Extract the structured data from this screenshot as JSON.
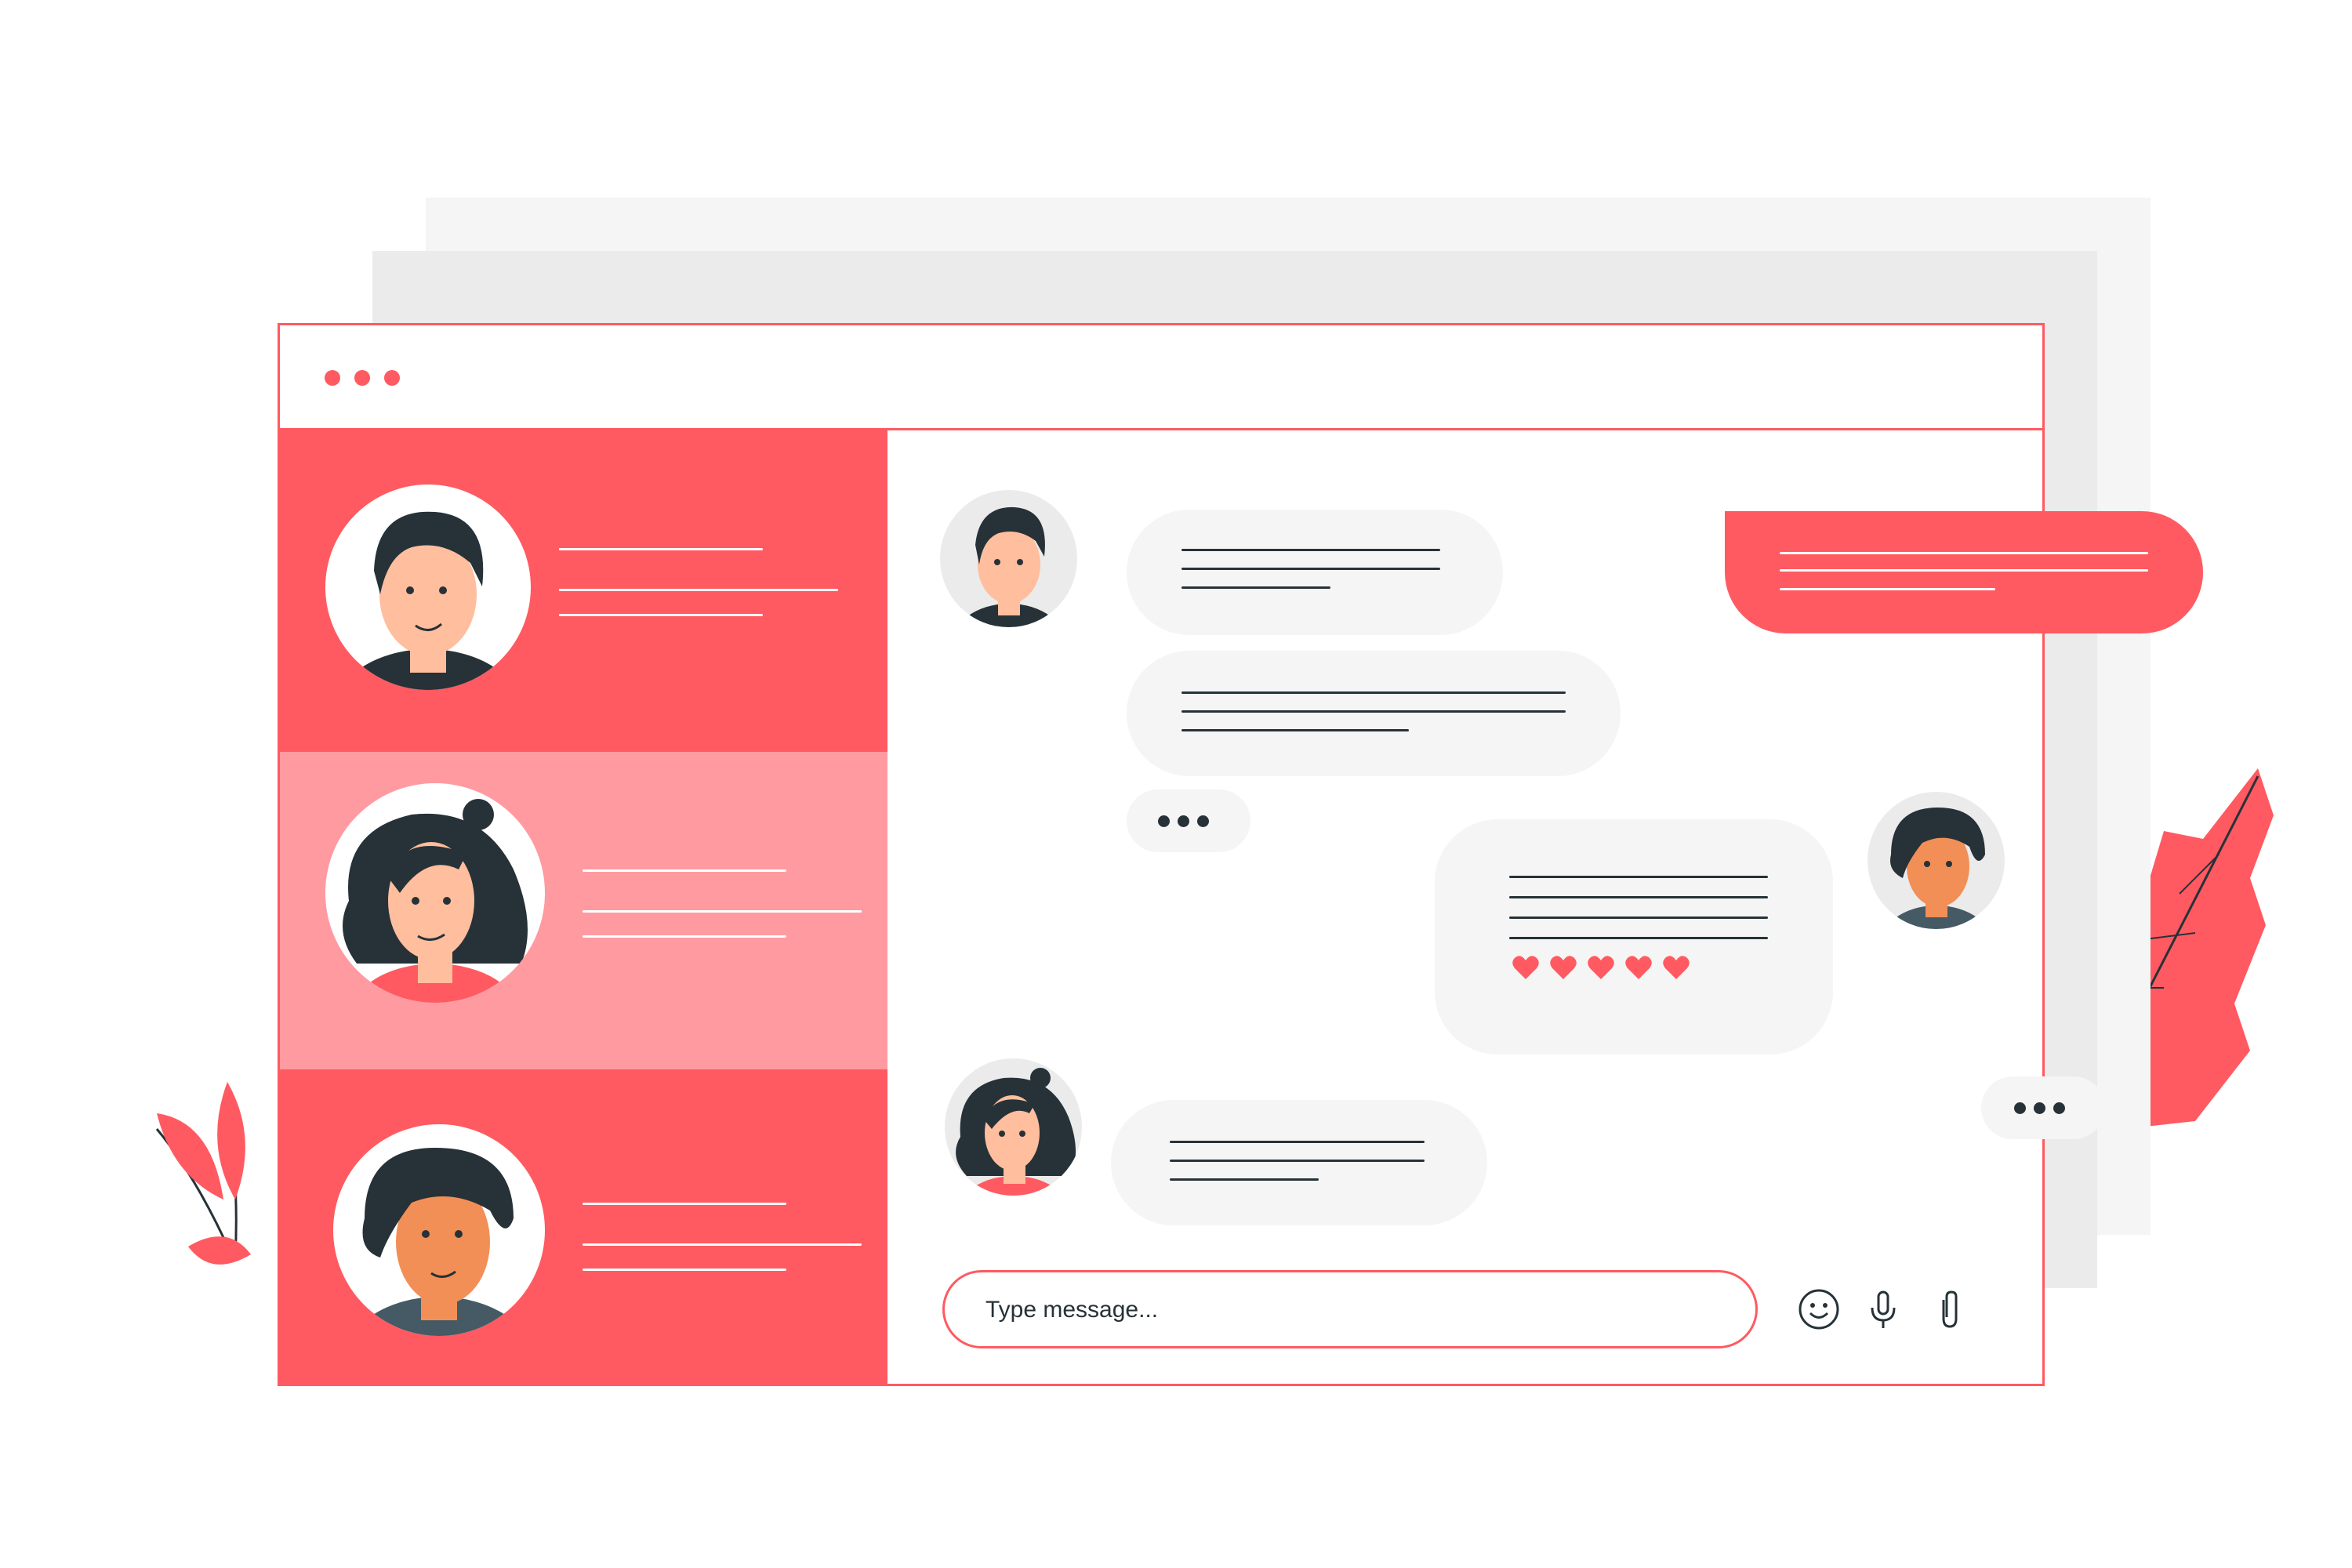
{
  "window": {
    "controls": [
      "dot-1",
      "dot-2",
      "dot-3"
    ],
    "accent_color": "#ff5a61",
    "accent_light": "#ff9aa1"
  },
  "contacts": [
    {
      "name_hidden": true,
      "selected": false,
      "avatar": "man-short-hair-avatar"
    },
    {
      "name_hidden": true,
      "selected": true,
      "avatar": "woman-curly-hair-avatar"
    },
    {
      "name_hidden": true,
      "selected": false,
      "avatar": "man-wavy-hair-avatar"
    }
  ],
  "composer": {
    "placeholder": "Type message...",
    "icons": [
      "emoji-icon",
      "microphone-icon",
      "attachment-icon"
    ]
  },
  "reactions": {
    "hearts": 5
  }
}
